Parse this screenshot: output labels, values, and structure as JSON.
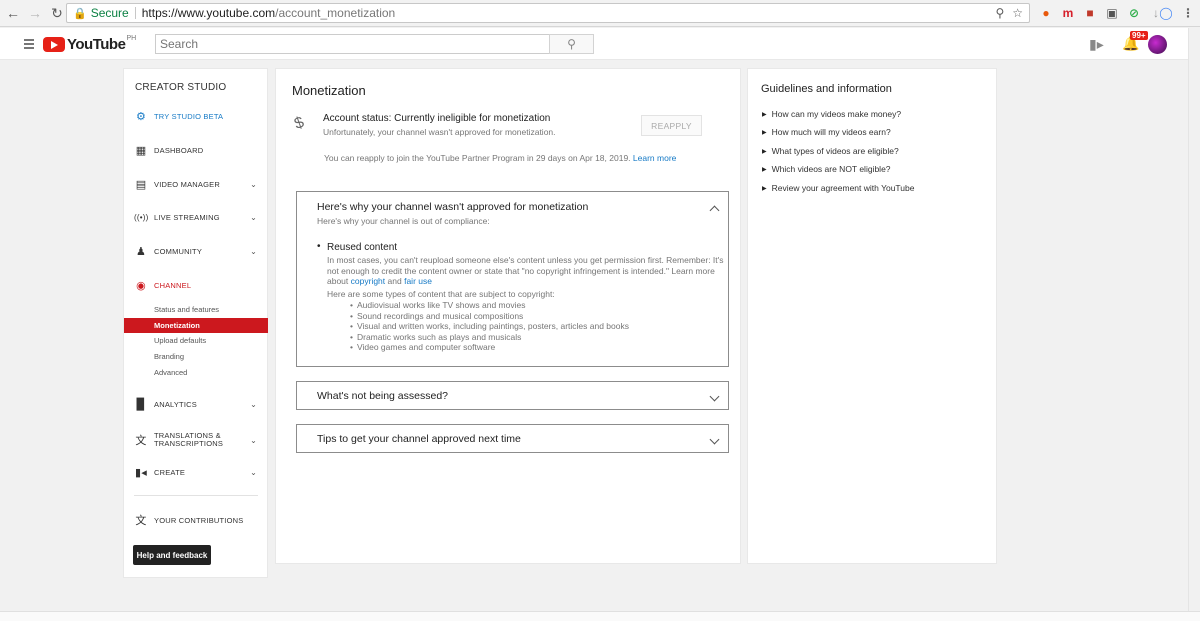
{
  "browser": {
    "secure_label": "Secure",
    "url_host": "https://www.youtube.com",
    "url_path": "/account_monetization"
  },
  "masthead": {
    "region": "PH",
    "search_placeholder": "Search",
    "notification_count": "99+"
  },
  "sidebar": {
    "title": "CREATOR STUDIO",
    "items": [
      {
        "label": "TRY STUDIO BETA"
      },
      {
        "label": "DASHBOARD"
      },
      {
        "label": "VIDEO MANAGER"
      },
      {
        "label": "LIVE STREAMING"
      },
      {
        "label": "COMMUNITY"
      },
      {
        "label": "CHANNEL"
      },
      {
        "label": "ANALYTICS"
      },
      {
        "label": "TRANSLATIONS &"
      },
      {
        "label": "CREATE"
      },
      {
        "label": "YOUR CONTRIBUTIONS"
      }
    ],
    "translations_line2": "TRANSCRIPTIONS",
    "channel_sub": [
      "Status and features",
      "Monetization",
      "Upload defaults",
      "Branding",
      "Advanced"
    ],
    "help_label": "Help and feedback"
  },
  "main": {
    "title": "Monetization",
    "status_heading": "Account status: Currently ineligible for monetization",
    "status_sub": "Unfortunately, your channel wasn't approved for monetization.",
    "reapply_label": "REAPPLY",
    "reapply_text": "You can reapply to join the YouTube Partner Program in 29 days on Apr 18, 2019.",
    "learn_more": "Learn more",
    "why": {
      "heading": "Here's why your channel wasn't approved for monetization",
      "sub": "Here's why your channel is out of compliance:",
      "bullet_title": "Reused content",
      "para": "In most cases, you can't reupload someone else's content unless you get permission first. Remember: It's not enough to credit the content owner or state that \"no copyright infringement is intended.\" Learn more about",
      "link_copyright": "copyright",
      "and": "and",
      "link_fair_use": "fair use",
      "types_intro": "Here are some types of content that are subject to copyright:",
      "types": [
        "Audiovisual works like TV shows and movies",
        "Sound recordings and musical compositions",
        "Visual and written works, including paintings, posters, articles and books",
        "Dramatic works such as plays and musicals",
        "Video games and computer software"
      ]
    },
    "not_assessed": "What's not being assessed?",
    "tips": "Tips to get your channel approved next time"
  },
  "guidelines": {
    "title": "Guidelines and information",
    "items": [
      "How can my videos make money?",
      "How much will my videos earn?",
      "What types of videos are eligible?",
      "Which videos are NOT eligible?",
      "Review your agreement with YouTube"
    ]
  }
}
